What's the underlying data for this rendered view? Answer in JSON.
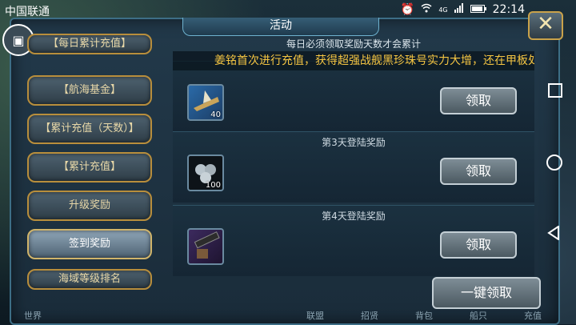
{
  "statusbar": {
    "carrier": "中国联通",
    "network": "4G",
    "time": "22:14"
  },
  "panel": {
    "title": "活动",
    "close_label": "✕",
    "avatar_icon": "▣"
  },
  "menu": {
    "items": [
      {
        "label": "【每日累计充值】"
      },
      {
        "label": "【航海基金】"
      },
      {
        "label": "【累计充值（天数）】"
      },
      {
        "label": "【累计充值】"
      },
      {
        "label": "升级奖励"
      },
      {
        "label": "签到奖励"
      },
      {
        "label": "海域等级排名"
      }
    ],
    "active_index": 5
  },
  "content": {
    "subheader": "每日必须领取奖励天数才会累计",
    "marquee": "姜铭首次进行充值，获得超强战舰黑珍珠号实力大增，还在甲板处发现了氪",
    "rows": [
      {
        "title": "",
        "item": "ship-item-icon",
        "count": "40",
        "claim_label": "领取"
      },
      {
        "title": "第3天登陆奖励",
        "item": "cannonball-item-icon",
        "count": "100",
        "claim_label": "领取"
      },
      {
        "title": "第4天登陆奖励",
        "item": "cannon-item-icon",
        "count": "",
        "claim_label": "领取"
      }
    ],
    "claim_all_label": "一键领取"
  },
  "bottom": {
    "tabs": [
      "联盟",
      "招贤",
      "背包",
      "船只",
      "充值"
    ],
    "left_label": "世界"
  },
  "colors": {
    "accent_gold": "#b88e3c",
    "marquee_text": "#f5c542",
    "panel_border": "#3d6e86"
  }
}
